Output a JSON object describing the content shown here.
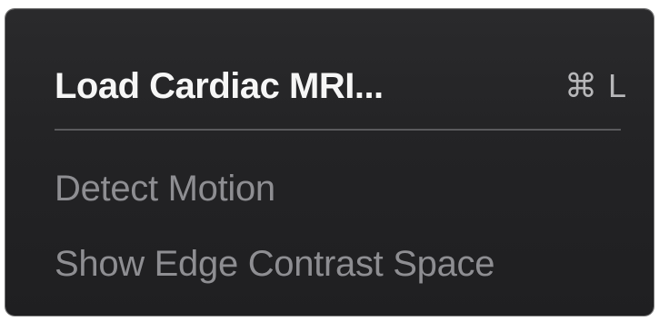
{
  "menu": {
    "items": [
      {
        "label": "Load Cardiac MRI...",
        "shortcut": {
          "modifier": "⌘",
          "key": "L"
        },
        "enabled": true
      },
      {
        "label": "Detect Motion",
        "enabled": false
      },
      {
        "label": "Show Edge Contrast Space",
        "enabled": false
      }
    ]
  },
  "colors": {
    "menu_background": "#242426",
    "enabled_text": "#f6f6f6",
    "disabled_text": "#8e8e92",
    "shortcut_text": "#b7b7b9",
    "separator": "#5a5a5d"
  }
}
